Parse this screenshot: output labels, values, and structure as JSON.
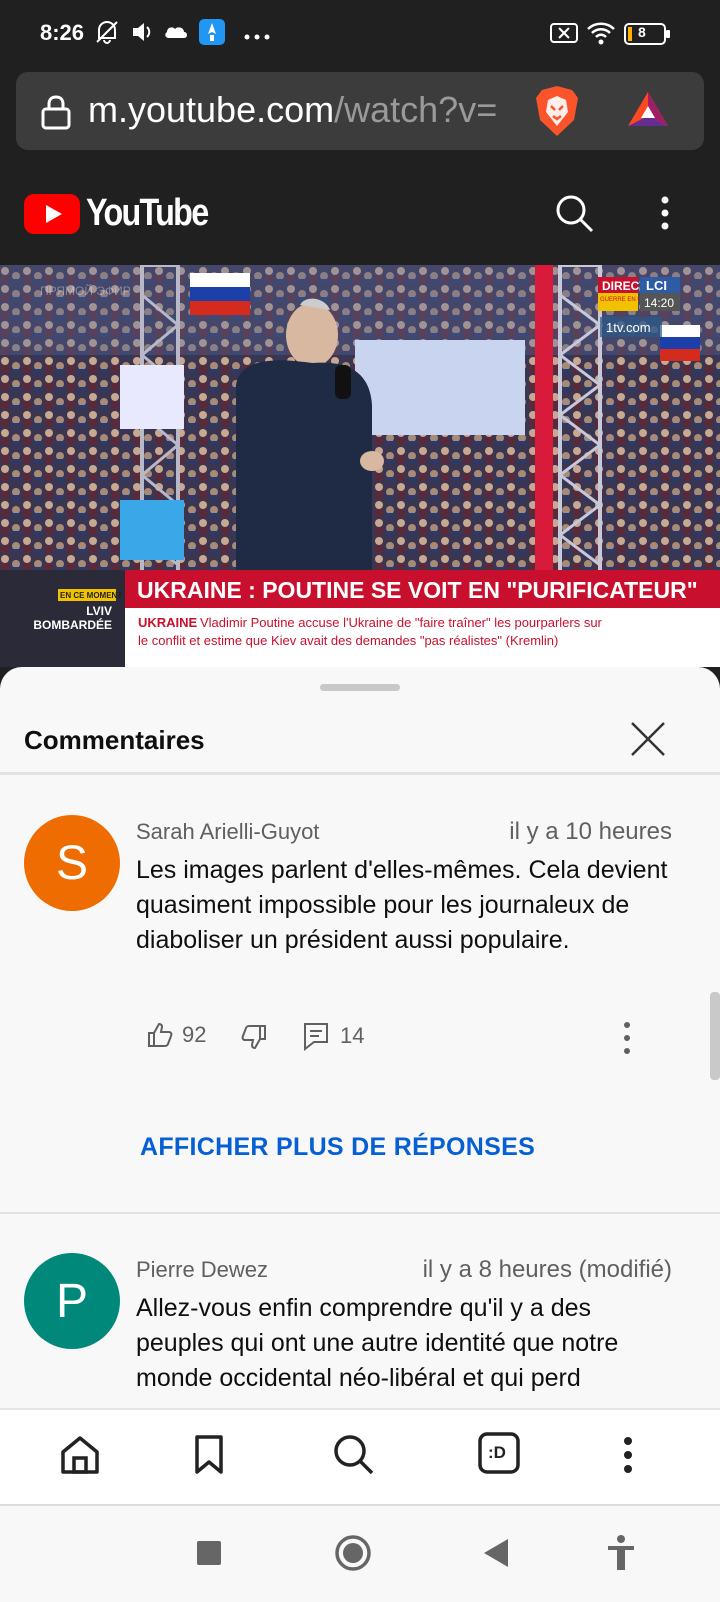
{
  "status_bar": {
    "time": "8:26",
    "battery": "8"
  },
  "browser": {
    "url_host": "m.youtube.com",
    "url_path": "/watch?v="
  },
  "header": {
    "brand": "YouTube"
  },
  "video": {
    "channel_logo": "LCI",
    "live_label": "DIRECT",
    "war_label": "GUERRE EN UKRAINE",
    "clock": "14:20",
    "site": "1tv.com",
    "watermark": "ПРЯМОЙ ЭФИР",
    "side_tag": "EN CE MOMENT",
    "side_text": "LVIV\nBOMBARDÉE",
    "headline": "UKRAINE : POUTINE SE VOIT EN \"PURIFICATEUR\"",
    "subhead_label": "UKRAINE",
    "subhead_line1": "Vladimir Poutine accuse l'Ukraine de \"faire traîner\" les pourparlers sur",
    "subhead_line2": "le conflit et estime que Kiev avait des demandes \"pas réalistes\" (Kremlin)"
  },
  "comments_panel": {
    "title": "Commentaires",
    "show_more_replies": "AFFICHER PLUS DE RÉPONSES",
    "comments": [
      {
        "avatar_letter": "S",
        "avatar_color": "#ef6c00",
        "author": "Sarah Arielli-Guyot",
        "time": "il y a 10 heures",
        "text": "Les images parlent d'elles-mêmes. Cela devient quasiment impossible pour les journaleux de diaboliser un président aussi populaire.",
        "likes": "92",
        "replies": "14"
      },
      {
        "avatar_letter": "P",
        "avatar_color": "#00897b",
        "author": "Pierre Dewez",
        "time": "il y a 8 heures (modifié)",
        "text": "Allez-vous enfin comprendre qu'il y a des peuples qui ont une autre identité que notre monde occidental néo-libéral et qui perd"
      }
    ]
  },
  "bottom_nav": {
    "items": [
      "home-icon",
      "bookmark-icon",
      "search-icon",
      "tabs-icon",
      "more-icon"
    ],
    "tabs_label": ":D"
  }
}
